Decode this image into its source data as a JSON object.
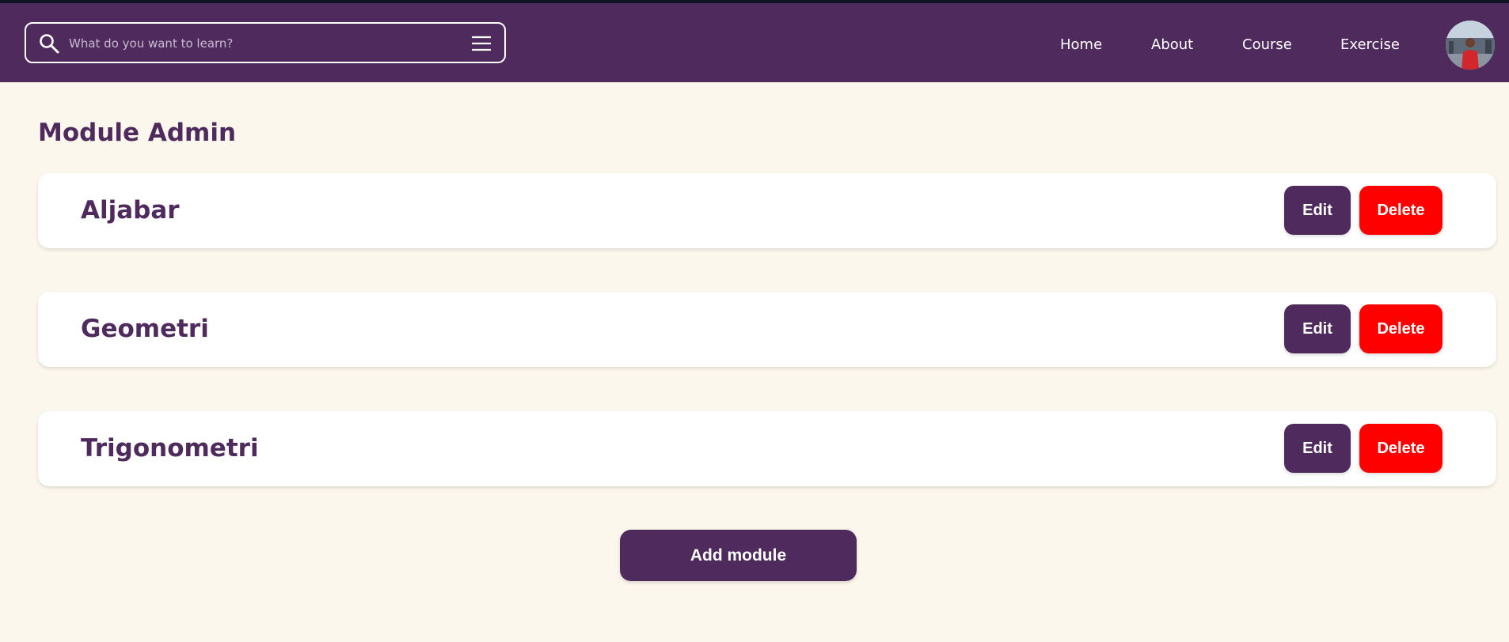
{
  "search": {
    "placeholder": "What do you want to learn?",
    "value": ""
  },
  "nav": {
    "items": [
      {
        "label": "Home"
      },
      {
        "label": "About"
      },
      {
        "label": "Course"
      },
      {
        "label": "Exercise"
      }
    ]
  },
  "page": {
    "title": "Module Admin"
  },
  "modules": [
    {
      "name": "Aljabar",
      "edit_label": "Edit",
      "delete_label": "Delete"
    },
    {
      "name": "Geometri",
      "edit_label": "Edit",
      "delete_label": "Delete"
    },
    {
      "name": "Trigonometri",
      "edit_label": "Edit",
      "delete_label": "Delete"
    }
  ],
  "actions": {
    "add_label": "Add module"
  },
  "colors": {
    "brand": "#4e2a5d",
    "background": "#fcf7ec",
    "danger": "#ff0000",
    "card": "#ffffff"
  },
  "icons": {
    "search": "search-icon",
    "menu": "menu-icon",
    "avatar": "user-avatar"
  }
}
